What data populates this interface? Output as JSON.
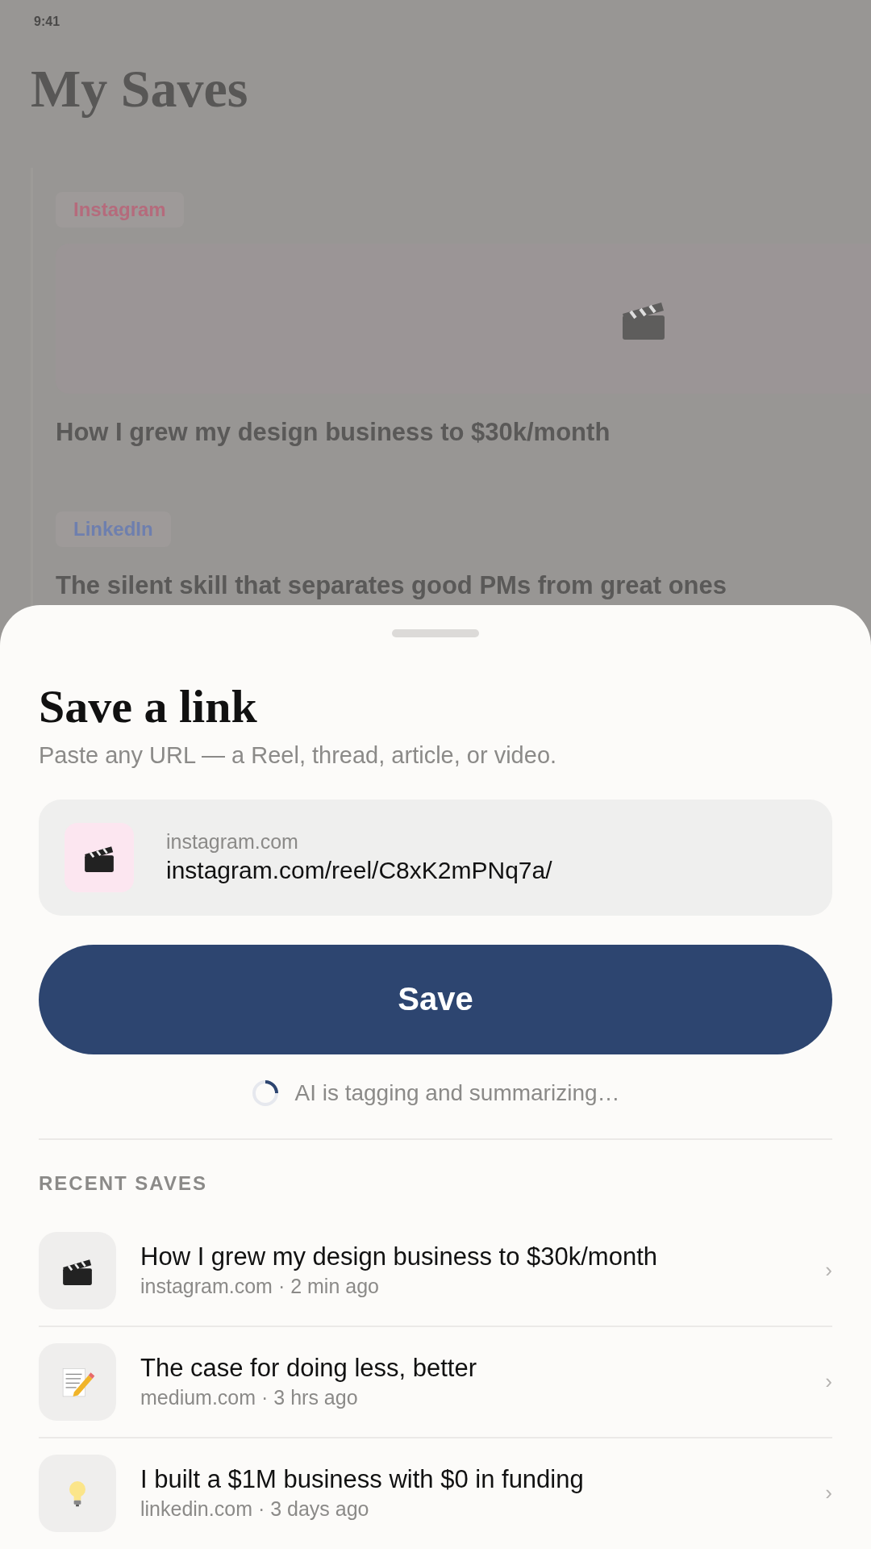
{
  "status_bar": {
    "time": "9:41"
  },
  "page": {
    "title": "My Saves",
    "cards": [
      {
        "kind": "video",
        "tag": {
          "label": "Instagram",
          "color": "#b56b7c"
        },
        "title": "How I grew my design business to $30k/month"
      },
      {
        "kind": "post",
        "tag": {
          "label": "LinkedIn",
          "color": "#6e7fae"
        },
        "title": "The silent skill that separates good PMs from great ones"
      }
    ]
  },
  "sheet": {
    "title": "Save a link",
    "subtitle": "Paste any URL — a Reel, thread, article, or video.",
    "field": {
      "kind": "video",
      "domain": "instagram.com",
      "value": "instagram.com/reel/C8xK2mPNq7a/"
    },
    "save_button": "Save",
    "status": "AI is tagging and summarizing…",
    "recent_heading": "RECENT SAVES",
    "recent": [
      {
        "kind": "video",
        "title": "How I grew my design business to $30k/month",
        "meta": "instagram.com · 2 min ago",
        "chevron": "›"
      },
      {
        "kind": "article",
        "title": "The case for doing less, better",
        "meta": "medium.com · 3 hrs ago",
        "chevron": "›"
      },
      {
        "kind": "idea",
        "title": "I built a $1M business with $0 in funding",
        "meta": "linkedin.com · 3 days ago",
        "chevron": "›"
      }
    ]
  }
}
